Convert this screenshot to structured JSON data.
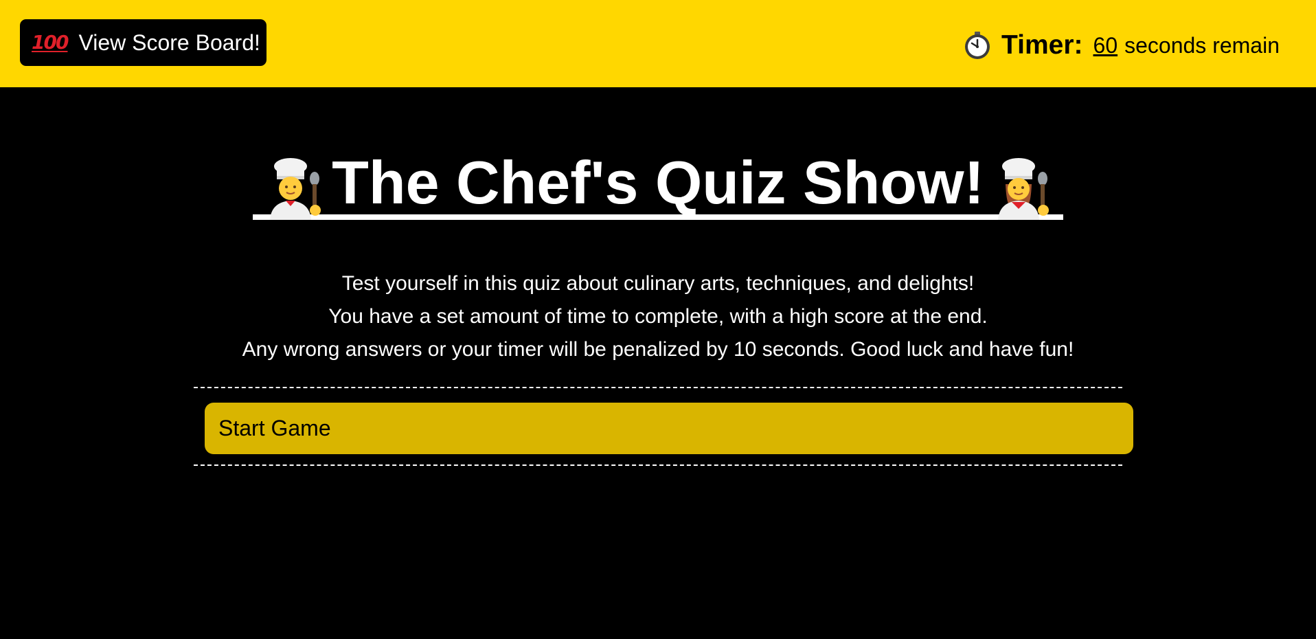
{
  "header": {
    "background_color": "#ffd700",
    "score_button": {
      "icon": "hundred-points-icon",
      "icon_text": "100",
      "label": "View Score Board!"
    },
    "timer": {
      "icon": "clock-icon",
      "label": "Timer:",
      "value": "60",
      "suffix": "seconds remain"
    }
  },
  "main": {
    "title": "The Chef's Quiz Show!",
    "title_icons": [
      "man-cook-icon",
      "woman-cook-icon"
    ],
    "intro_lines": [
      "Test yourself in this quiz about culinary arts, techniques, and delights!",
      "You have a set amount of time to complete, with a high score at the end.",
      "Any wrong answers or your timer will be penalized by 10 seconds. Good luck and have fun!"
    ],
    "start_button": {
      "label": "Start Game",
      "color": "#d9b500"
    }
  }
}
